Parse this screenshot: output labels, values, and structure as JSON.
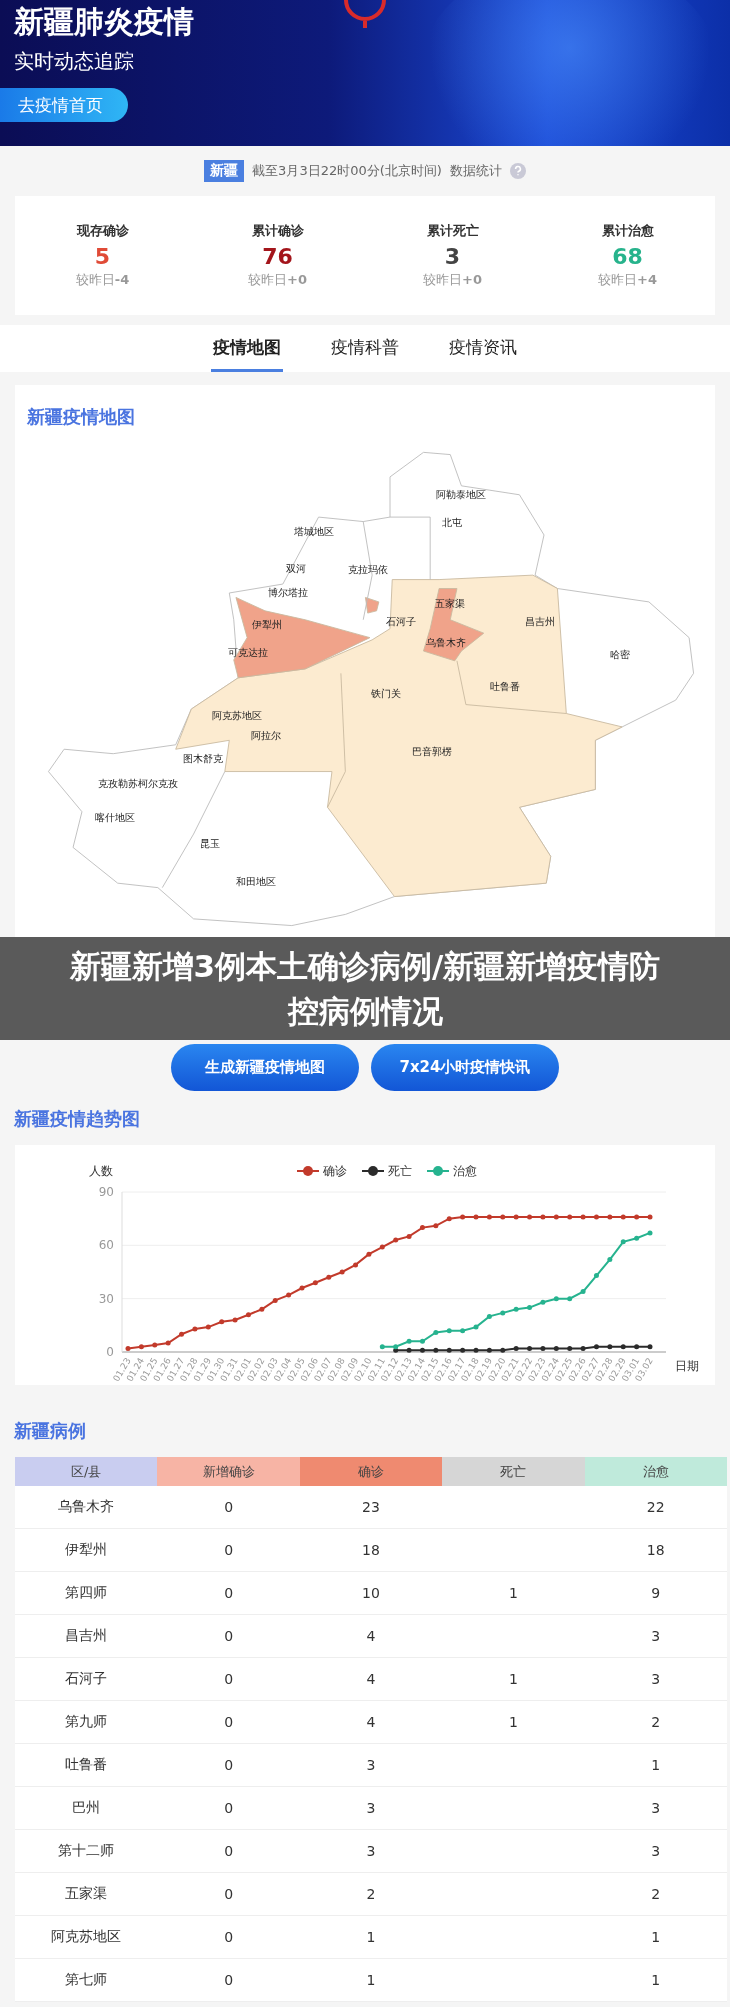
{
  "header": {
    "title": "新疆肺炎疫情",
    "subtitle": "实时动态追踪",
    "home_button": "去疫情首页"
  },
  "update": {
    "region_tag": "新疆",
    "time": "截至3月3日22时00分(北京时间)",
    "suffix": "数据统计"
  },
  "stats": [
    {
      "label": "现存确诊",
      "value": "5",
      "change_label": "较昨日",
      "change": "-4",
      "color": "#e04b37"
    },
    {
      "label": "累计确诊",
      "value": "76",
      "change_label": "较昨日",
      "change": "+0",
      "color": "#a3151b"
    },
    {
      "label": "累计死亡",
      "value": "3",
      "change_label": "较昨日",
      "change": "+0",
      "color": "#444444"
    },
    {
      "label": "累计治愈",
      "value": "68",
      "change_label": "较昨日",
      "change": "+4",
      "color": "#27b38c"
    }
  ],
  "tabs": [
    {
      "label": "疫情地图",
      "selected": true
    },
    {
      "label": "疫情科普",
      "selected": false
    },
    {
      "label": "疫情资讯",
      "selected": false
    }
  ],
  "map": {
    "title": "新疆疫情地图",
    "regions": [
      "阿勒泰地区",
      "北屯",
      "塔城地区",
      "双河",
      "克拉玛依",
      "博尔塔拉",
      "五家渠",
      "伊犁州",
      "石河子",
      "昌吉州",
      "乌鲁木齐",
      "哈密",
      "可克达拉",
      "铁门关",
      "吐鲁番",
      "阿克苏地区",
      "阿拉尔",
      "巴音郭楞",
      "图木舒克",
      "克孜勒苏柯尔克孜",
      "喀什地区",
      "昆玉",
      "和田地区"
    ]
  },
  "caption": "新疆新增3例本土确诊病例/新疆新增疫情防控病例情况",
  "actions": [
    "生成新疆疫情地图",
    "7x24小时疫情快讯"
  ],
  "trend": {
    "title": "新疆疫情趋势图",
    "chart_data": {
      "type": "line",
      "xlabel": "日期",
      "ylabel": "人数",
      "legend": "top",
      "categories": [
        "01.23",
        "01.24",
        "01.25",
        "01.26",
        "01.27",
        "01.28",
        "01.29",
        "01.30",
        "01.31",
        "02.01",
        "02.02",
        "02.03",
        "02.04",
        "02.05",
        "02.06",
        "02.07",
        "02.08",
        "02.09",
        "02.10",
        "02.11",
        "02.12",
        "02.13",
        "02.14",
        "02.15",
        "02.16",
        "02.17",
        "02.18",
        "02.19",
        "02.20",
        "02.21",
        "02.22",
        "02.23",
        "02.24",
        "02.25",
        "02.26",
        "02.27",
        "02.28",
        "02.29",
        "03.01",
        "03.02"
      ],
      "ylim": [
        0,
        90
      ],
      "yticks": [
        0,
        30,
        60,
        90
      ],
      "series": [
        {
          "name": "确诊",
          "color": "#c23a2b",
          "values": [
            2,
            3,
            4,
            5,
            10,
            13,
            14,
            17,
            18,
            21,
            24,
            29,
            32,
            36,
            39,
            42,
            45,
            49,
            55,
            59,
            63,
            65,
            70,
            71,
            75,
            76,
            76,
            76,
            76,
            76,
            76,
            76,
            76,
            76,
            76,
            76,
            76,
            76,
            76,
            76
          ]
        },
        {
          "name": "死亡",
          "color": "#2b2b2b",
          "values": [
            null,
            null,
            null,
            null,
            null,
            null,
            null,
            null,
            null,
            null,
            null,
            null,
            null,
            null,
            null,
            null,
            null,
            null,
            null,
            null,
            1,
            1,
            1,
            1,
            1,
            1,
            1,
            1,
            1,
            2,
            2,
            2,
            2,
            2,
            2,
            3,
            3,
            3,
            3,
            3
          ]
        },
        {
          "name": "治愈",
          "color": "#26b38f",
          "values": [
            null,
            null,
            null,
            null,
            null,
            null,
            null,
            null,
            null,
            null,
            null,
            null,
            null,
            null,
            null,
            null,
            null,
            null,
            null,
            3,
            3,
            6,
            6,
            11,
            12,
            12,
            14,
            20,
            22,
            24,
            25,
            28,
            30,
            30,
            34,
            43,
            52,
            62,
            64,
            67
          ]
        }
      ]
    }
  },
  "cases": {
    "title": "新疆病例",
    "columns": [
      {
        "label": "区/县",
        "color": "#c9cdf0"
      },
      {
        "label": "新增确诊",
        "color": "#f7b4a5"
      },
      {
        "label": "确诊",
        "color": "#ef8a70"
      },
      {
        "label": "死亡",
        "color": "#d6d6d6"
      },
      {
        "label": "治愈",
        "color": "#bfeadb"
      }
    ],
    "rows": [
      {
        "area": "乌鲁木齐",
        "new": "0",
        "confirmed": "23",
        "healed": "22"
      },
      {
        "area": "伊犁州",
        "new": "0",
        "confirmed": "18",
        "healed": "18"
      },
      {
        "area": "第四师",
        "new": "0",
        "confirmed": "10",
        "deaths": "1",
        "healed": "9"
      },
      {
        "area": "昌吉州",
        "new": "0",
        "confirmed": "4",
        "healed": "3"
      },
      {
        "area": "石河子",
        "new": "0",
        "confirmed": "4",
        "deaths": "1",
        "healed": "3"
      },
      {
        "area": "第九师",
        "new": "0",
        "confirmed": "4",
        "deaths": "1",
        "healed": "2"
      },
      {
        "area": "吐鲁番",
        "new": "0",
        "confirmed": "3",
        "healed": "1"
      },
      {
        "area": "巴州",
        "new": "0",
        "confirmed": "3",
        "healed": "3"
      },
      {
        "area": "第十二师",
        "new": "0",
        "confirmed": "3",
        "healed": "3"
      },
      {
        "area": "五家渠",
        "new": "0",
        "confirmed": "2",
        "healed": "2"
      },
      {
        "area": "阿克苏地区",
        "new": "0",
        "confirmed": "1",
        "healed": "1"
      },
      {
        "area": "第七师",
        "new": "0",
        "confirmed": "1",
        "healed": "1"
      }
    ]
  }
}
